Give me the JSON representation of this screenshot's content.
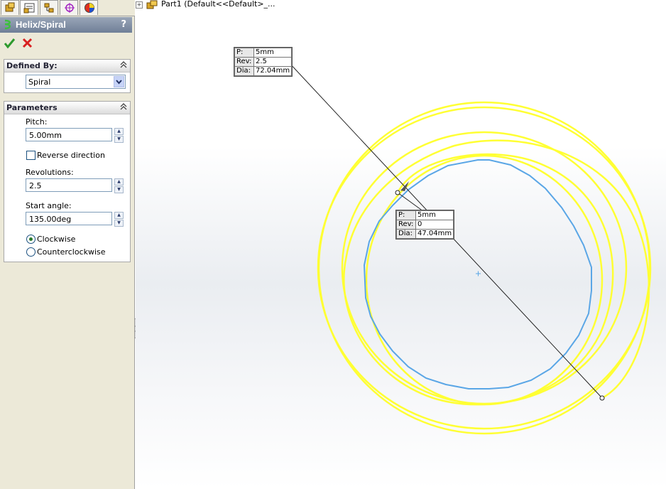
{
  "tabs": [
    {
      "name": "feature-manager-icon"
    },
    {
      "name": "property-manager-icon"
    },
    {
      "name": "configuration-manager-icon"
    },
    {
      "name": "dimxpert-manager-icon"
    },
    {
      "name": "display-manager-icon"
    }
  ],
  "property_manager": {
    "title": "Helix/Spiral",
    "help": "?",
    "ok_icon": "checkmark-icon",
    "cancel_icon": "cross-icon"
  },
  "defined_by": {
    "heading": "Defined By:",
    "selected": "Spiral"
  },
  "parameters": {
    "heading": "Parameters",
    "pitch_label": "Pitch:",
    "pitch_value": "5.00mm",
    "reverse_label": "Reverse direction",
    "reverse_checked": false,
    "revolutions_label": "Revolutions:",
    "revolutions_value": "2.5",
    "start_angle_label": "Start angle:",
    "start_angle_value": "135.00deg",
    "clockwise_label": "Clockwise",
    "counterclockwise_label": "Counterclockwise",
    "direction": "Clockwise"
  },
  "tree": {
    "expand": "+",
    "label": "Part1  (Default<<Default>_..."
  },
  "callout_end": {
    "p_key": "P:",
    "p_val": "5mm",
    "rev_key": "Rev:",
    "rev_val": "2.5",
    "dia_key": "Dia:",
    "dia_val": "72.04mm"
  },
  "callout_start": {
    "p_key": "P:",
    "p_val": "5mm",
    "rev_key": "Rev:",
    "rev_val": "0",
    "dia_key": "Dia:",
    "dia_val": "47.04mm"
  },
  "colors": {
    "spiral_preview": "#ffff33",
    "base_circle": "#5aa6e6",
    "panel_bg": "#ece9d8",
    "title_bar": "#7f8ea4"
  }
}
